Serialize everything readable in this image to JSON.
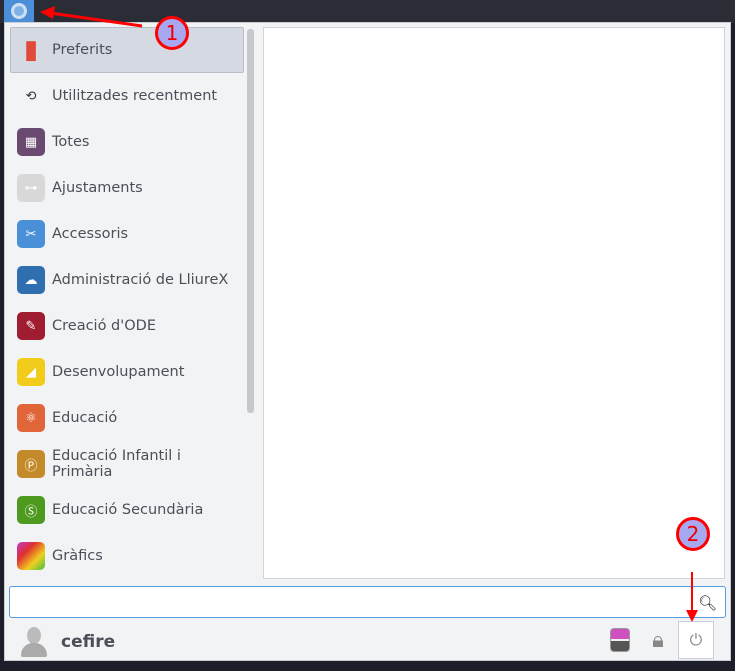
{
  "menu": {
    "items": [
      {
        "label": "Preferits",
        "icon": "bookmark-icon",
        "color": "#e04a3a",
        "glyph": "▮"
      },
      {
        "label": "Utilitzades recentment",
        "icon": "history-icon",
        "color": "transparent",
        "glyph": "⟲"
      },
      {
        "label": "Totes",
        "icon": "grid-icon",
        "color": "#6b4a72",
        "glyph": "▦"
      },
      {
        "label": "Ajustaments",
        "icon": "settings-toggle-icon",
        "color": "#d8d8d8",
        "glyph": "⊶"
      },
      {
        "label": "Accessoris",
        "icon": "scissors-icon",
        "color": "#4a90d9",
        "glyph": "✂"
      },
      {
        "label": "Administració de LliureX",
        "icon": "lliurex-icon",
        "color": "#2f6fb0",
        "glyph": "☁"
      },
      {
        "label": "Creació d'ODE",
        "icon": "ode-icon",
        "color": "#a01c30",
        "glyph": "✎"
      },
      {
        "label": "Desenvolupament",
        "icon": "development-icon",
        "color": "#f1cc1a",
        "glyph": "◢"
      },
      {
        "label": "Educació",
        "icon": "atom-icon",
        "color": "#e0663a",
        "glyph": "⚛"
      },
      {
        "label": "Educació Infantil i Primària",
        "icon": "primary-icon",
        "color": "#c48a2a",
        "glyph": "Ⓟ"
      },
      {
        "label": "Educació Secundària",
        "icon": "secondary-icon",
        "color": "#4e9a1e",
        "glyph": "Ⓢ"
      },
      {
        "label": "Gràfics",
        "icon": "graphics-icon",
        "color": "linear-gradient(135deg,#c03ad0,#e03030,#f0d020,#40c040)",
        "glyph": ""
      }
    ]
  },
  "search": {
    "value": "",
    "placeholder": ""
  },
  "user": {
    "name": "cefire"
  },
  "annotations": [
    "1",
    "2"
  ]
}
